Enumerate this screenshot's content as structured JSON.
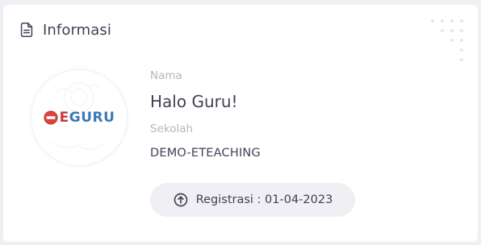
{
  "card": {
    "title": "Informasi",
    "title_icon": "document-icon",
    "decoration_icon": "dot-grid-icon"
  },
  "logo": {
    "brand": "EGURU",
    "icon": "eguru-logo"
  },
  "fields": {
    "name_label": "Nama",
    "name_value": "Halo Guru!",
    "school_label": "Sekolah",
    "school_value": "DEMO-ETEACHING"
  },
  "registration": {
    "icon": "arrow-up-circle-icon",
    "text": "Registrasi : 01-04-2023"
  },
  "colors": {
    "card_bg": "#ffffff",
    "page_bg": "#eef0f4",
    "text_primary": "#3f4254",
    "text_muted": "#b5b5c3",
    "pill_bg": "#f0f0f4",
    "logo_blue": "#3b79b5",
    "logo_red": "#c33b3b"
  }
}
